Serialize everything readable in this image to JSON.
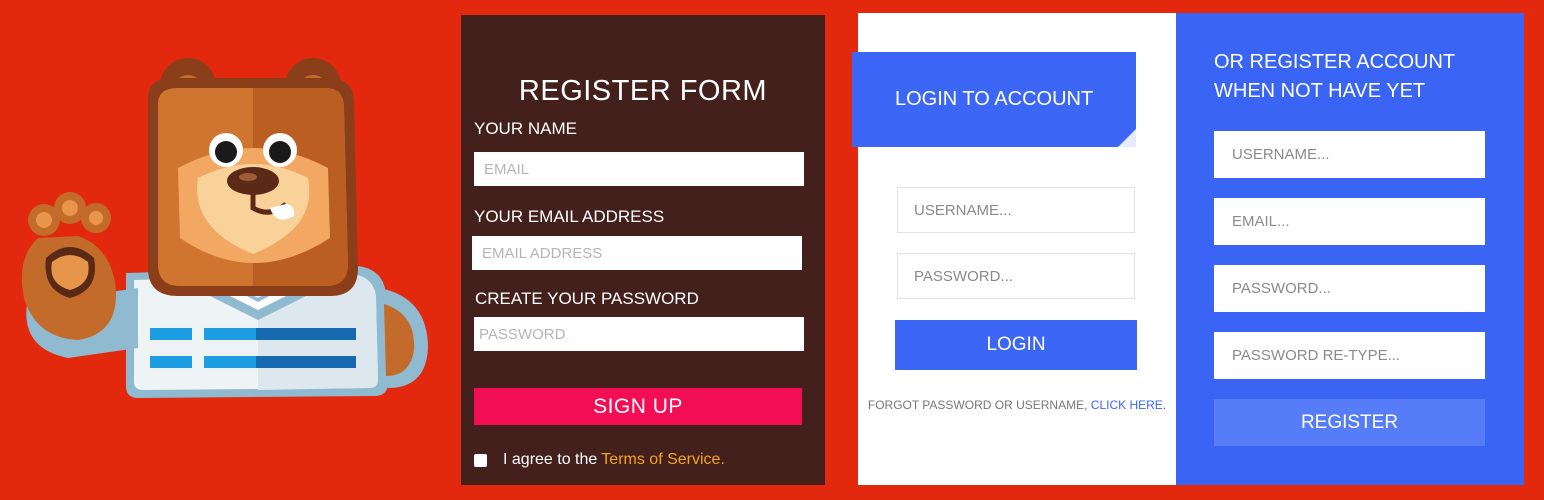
{
  "register_form": {
    "title": "REGISTER FORM",
    "name_label": "YOUR NAME",
    "name_placeholder": "EMAIL",
    "email_label": "YOUR EMAIL ADDRESS",
    "email_placeholder": "EMAIL ADDRESS",
    "password_label": "CREATE YOUR PASSWORD",
    "password_placeholder": "PASSWORD",
    "signup_label": "SIGN UP",
    "terms_prefix": "I agree to the",
    "terms_link": "Terms of Service."
  },
  "login": {
    "title": "LOGIN TO ACCOUNT",
    "username_placeholder": "USERNAME...",
    "password_placeholder": "PASSWORD...",
    "button_label": "LOGIN",
    "forgot_prefix": "FORGOT PASSWORD OR USERNAME,",
    "forgot_link": "CLICK HERE."
  },
  "register_account": {
    "title": "OR REGISTER ACCOUNT WHEN NOT HAVE YET",
    "username_placeholder": "USERNAME...",
    "email_placeholder": "EMAIL...",
    "password_placeholder": "PASSWORD...",
    "password_retype_placeholder": "PASSWORD RE-TYPE...",
    "button_label": "REGISTER"
  },
  "colors": {
    "background": "#e2290d",
    "register_panel": "#44201c",
    "signup_button": "#f20e55",
    "terms_link": "#f4a41b",
    "accent_blue": "#3c66f6"
  },
  "icons": {
    "mascot": "bear-mascot-icon"
  }
}
